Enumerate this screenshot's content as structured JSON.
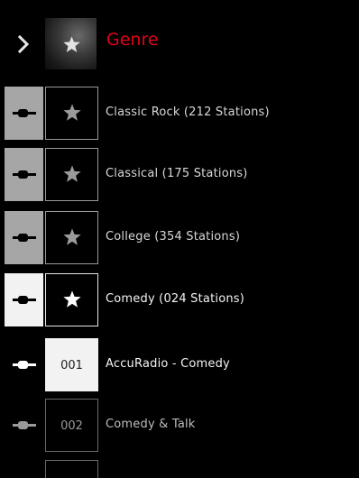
{
  "header": {
    "title": "Genre"
  },
  "genres": [
    {
      "label": "Classic Rock (212 Stations)"
    },
    {
      "label": "Classical (175 Stations)"
    },
    {
      "label": "College (354 Stations)"
    },
    {
      "label": "Comedy (024 Stations)"
    }
  ],
  "stations": [
    {
      "number": "001",
      "label": "AccuRadio - Comedy"
    },
    {
      "number": "002",
      "label": "Comedy & Talk"
    }
  ],
  "colors": {
    "accent": "#e2001a",
    "selected_cell": "#f2f2f2",
    "genre_cell": "#a6a6a6"
  },
  "icons": {
    "back": "chevron-right-icon",
    "favorite": "star-icon",
    "connection": "plug-icon"
  }
}
